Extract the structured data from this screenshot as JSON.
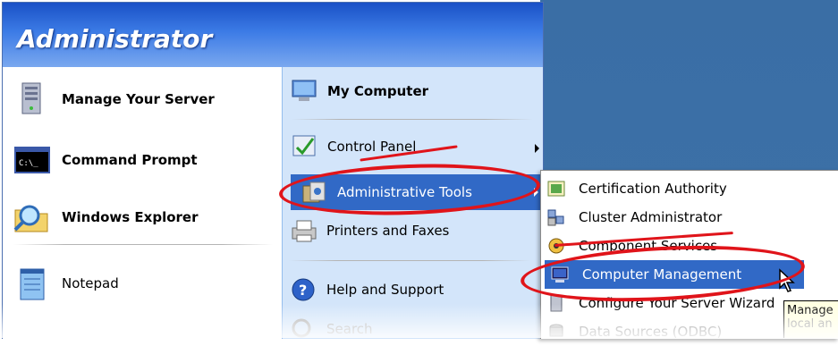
{
  "header": {
    "user": "Administrator"
  },
  "pinned": [
    {
      "label": "Manage Your Server",
      "icon": "server-icon"
    },
    {
      "label": "Command Prompt",
      "icon": "command-prompt-icon",
      "icon_text": "C:\\_"
    },
    {
      "label": "Windows Explorer",
      "icon": "magnifier-folder-icon"
    }
  ],
  "recent": [
    {
      "label": "Notepad",
      "icon": "notepad-icon"
    }
  ],
  "right_items": [
    {
      "label": "My Computer",
      "icon": "my-computer-icon"
    },
    {
      "label": "Control Panel",
      "icon": "control-panel-icon"
    },
    {
      "label": "Administrative Tools",
      "icon": "administrative-tools-icon"
    },
    {
      "label": "Printers and Faxes",
      "icon": "printer-icon"
    },
    {
      "label": "Help and Support",
      "icon": "help-icon"
    },
    {
      "label": "Search",
      "icon": "search-icon"
    }
  ],
  "submenu": [
    {
      "label": "Certification Authority",
      "icon": "certificate-icon"
    },
    {
      "label": "Cluster Administrator",
      "icon": "cluster-icon"
    },
    {
      "label": "Component Services",
      "icon": "component-services-icon"
    },
    {
      "label": "Computer Management",
      "icon": "computer-management-icon"
    },
    {
      "label": "Configure Your Server Wizard",
      "icon": "wizard-icon"
    },
    {
      "label": "Data Sources (ODBC)",
      "icon": "database-icon"
    }
  ],
  "tooltip": {
    "line1": "Manage",
    "line2": "local an"
  },
  "colors": {
    "header_blue": "#1a51c6",
    "highlight": "#3169c6",
    "annotation_red": "#e0141a",
    "desktop": "#3a6ea5"
  }
}
